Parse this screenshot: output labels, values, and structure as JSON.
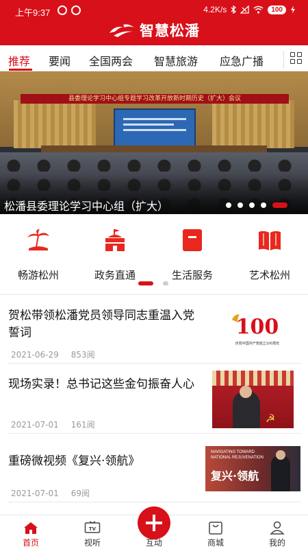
{
  "status_bar": {
    "time": "上午9:37",
    "net_speed": "4.2K/s",
    "battery": "100"
  },
  "header": {
    "app_title": "智慧松潘"
  },
  "tabs": [
    {
      "label": "推荐",
      "active": true
    },
    {
      "label": "要闻"
    },
    {
      "label": "全国两会"
    },
    {
      "label": "智慧旅游"
    },
    {
      "label": "应急广播"
    }
  ],
  "banner": {
    "stage_text": "县委理论学习中心组专题学习改革开放新时期历史（扩大）会议",
    "caption": "松潘县委理论学习中心组（扩大）",
    "dot_count": 5,
    "active_dot": 5
  },
  "services": [
    {
      "label": "畅游松州",
      "icon": "palm-island-icon"
    },
    {
      "label": "政务直通",
      "icon": "government-building-icon"
    },
    {
      "label": "生活服务",
      "icon": "bookmark-icon"
    },
    {
      "label": "艺术松州",
      "icon": "open-book-icon"
    }
  ],
  "news": [
    {
      "title": "贺松带领松潘党员领导同志重温入党誓词",
      "date": "2021-06-29",
      "views": "853阅"
    },
    {
      "title": "现场实录！总书记这些金句振奋人心",
      "date": "2021-07-01",
      "views": "161阅"
    },
    {
      "title": "重磅微视频《复兴·领航》",
      "date": "2021-07-01",
      "views": "69阅"
    }
  ],
  "thumb1": {
    "big": "100",
    "sub": "庆祝中国共产党成立100周年"
  },
  "thumb3": {
    "line1": "NAVIGATING TOWARD",
    "line2": "NATIONAL REJUVENATION",
    "title": "复兴·领航"
  },
  "bottom_nav": [
    {
      "label": "首页",
      "active": true
    },
    {
      "label": "视听"
    },
    {
      "label": "互动"
    },
    {
      "label": "商城"
    },
    {
      "label": "我的"
    }
  ],
  "colors": {
    "brand": "#d8101a",
    "text": "#222222",
    "meta": "#999999"
  }
}
